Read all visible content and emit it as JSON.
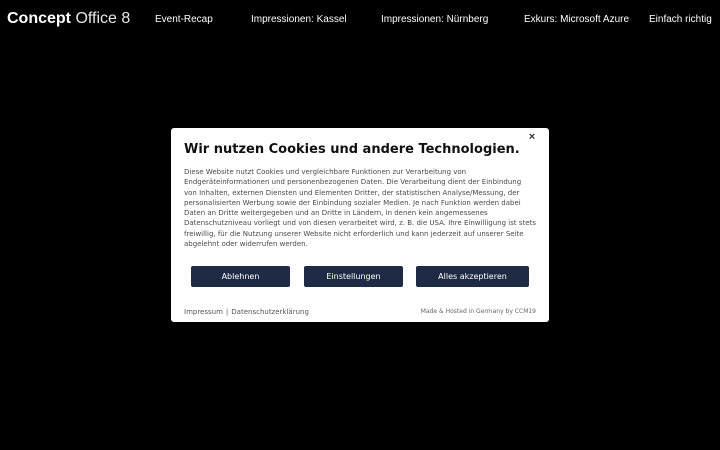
{
  "header": {
    "brand_bold": "Concept",
    "brand_light": "Office 8",
    "nav": [
      {
        "label": "Event-Recap"
      },
      {
        "label": "Impressionen: Kassel"
      },
      {
        "label": "Impressionen: Nürnberg"
      },
      {
        "label": "Exkurs: Microsoft Azure"
      },
      {
        "label": "Einfach richtig"
      }
    ]
  },
  "cookie_dialog": {
    "close_symbol": "×",
    "title": "Wir nutzen Cookies und andere Technologien.",
    "body": "Diese Website nutzt Cookies und vergleichbare Funktionen zur Verarbeitung von Endgeräteinformationen und personenbezogenen Daten. Die Verarbeitung dient der Einbindung von Inhalten, externen Diensten und Elementen Dritter, der statistischen Analyse/Messung, der personalisierten Werbung sowie der Einbindung sozialer Medien. Je nach Funktion werden dabei Daten an Dritte weitergegeben und an Dritte in Ländern, in denen kein angemessenes Datenschutzniveau vorliegt und von diesen verarbeitet wird, z. B. die USA. Ihre Einwilligung ist stets freiwillig, für die Nutzung unserer Website nicht erforderlich und kann jederzeit auf unserer Seite abgelehnt oder widerrufen werden.",
    "buttons": {
      "reject": "Ablehnen",
      "settings": "Einstellungen",
      "accept_all": "Alles akzeptieren"
    },
    "footer_links": {
      "imprint": "Impressum",
      "separator": "|",
      "privacy": "Datenschutzerklärung"
    },
    "footer_credit": "Made & Hosted in Germany by CCM19"
  },
  "colors": {
    "page_background": "#000000",
    "button_background": "#1f2a44",
    "dialog_background": "#ffffff"
  }
}
